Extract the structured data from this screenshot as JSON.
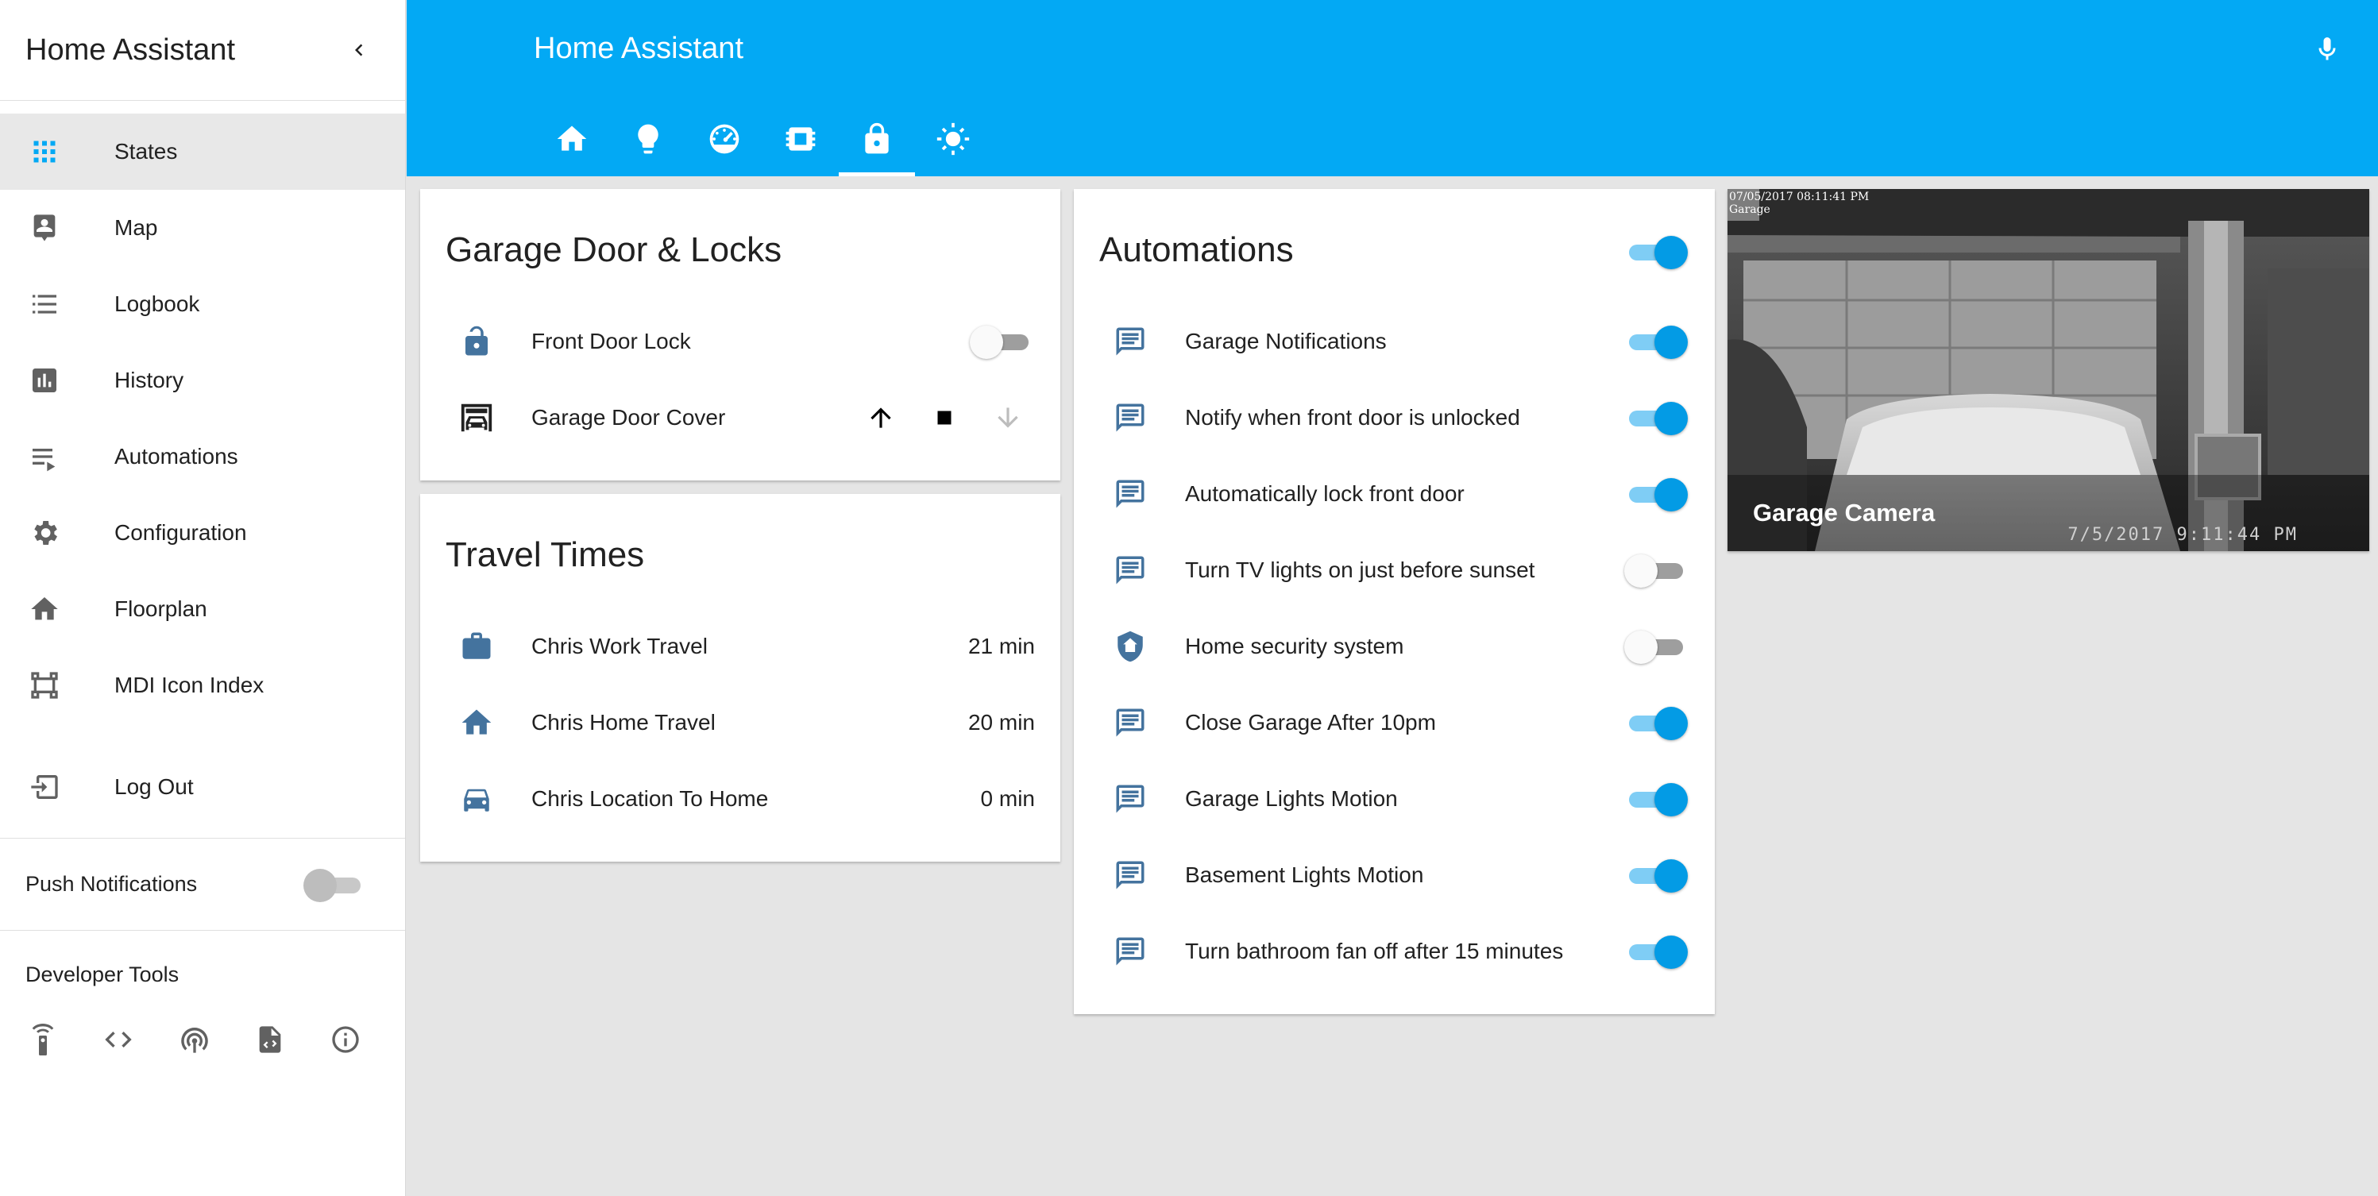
{
  "sidebar": {
    "title": "Home Assistant",
    "items": [
      {
        "label": "States",
        "icon": "grid-icon"
      },
      {
        "label": "Map",
        "icon": "account-location-icon"
      },
      {
        "label": "Logbook",
        "icon": "format-list-bulleted-icon"
      },
      {
        "label": "History",
        "icon": "chart-box-icon"
      },
      {
        "label": "Automations",
        "icon": "playlist-play-icon"
      },
      {
        "label": "Configuration",
        "icon": "gear-icon"
      },
      {
        "label": "Floorplan",
        "icon": "home-icon"
      },
      {
        "label": "MDI Icon Index",
        "icon": "vector-square-icon"
      }
    ],
    "logout_label": "Log Out",
    "push_label": "Push Notifications",
    "push_enabled": false,
    "dev_tools_label": "Developer Tools",
    "dev_tools_icons": [
      "remote-icon",
      "code-brackets-icon",
      "broadcast-icon",
      "file-code-icon",
      "info-icon"
    ]
  },
  "header": {
    "title": "Home Assistant",
    "tabs": [
      "home-icon",
      "lightbulb-icon",
      "gauge-icon",
      "chip-icon",
      "lock-icon",
      "weather-sunny-icon"
    ],
    "active_tab": 4
  },
  "colors": {
    "primary": "#03a9f4",
    "accent": "#039be5",
    "icon": "#44739e"
  },
  "garage_card": {
    "title": "Garage Door & Locks",
    "rows": [
      {
        "label": "Front Door Lock",
        "state": "off"
      },
      {
        "label": "Garage Door Cover"
      }
    ]
  },
  "travel_card": {
    "title": "Travel Times",
    "rows": [
      {
        "label": "Chris Work Travel",
        "value": "21 min"
      },
      {
        "label": "Chris Home Travel",
        "value": "20 min"
      },
      {
        "label": "Chris Location To Home",
        "value": "0 min"
      }
    ]
  },
  "automations_card": {
    "title": "Automations",
    "master_on": true,
    "rows": [
      {
        "label": "Garage Notifications",
        "on": true
      },
      {
        "label": "Notify when front door is unlocked",
        "on": true
      },
      {
        "label": "Automatically lock front door",
        "on": true
      },
      {
        "label": "Turn TV lights on just before sunset",
        "on": false
      },
      {
        "label": "Home security system",
        "on": false
      },
      {
        "label": "Close Garage After 10pm",
        "on": true
      },
      {
        "label": "Garage Lights Motion",
        "on": true
      },
      {
        "label": "Basement Lights Motion",
        "on": true
      },
      {
        "label": "Turn bathroom fan off after 15 minutes",
        "on": true
      }
    ]
  },
  "camera": {
    "name": "Garage Camera",
    "timestamp_top": "07/05/2017 08:11:41 PM",
    "label_top": "Garage",
    "timestamp_bottom": "7/5/2017 9:11:44 PM"
  }
}
